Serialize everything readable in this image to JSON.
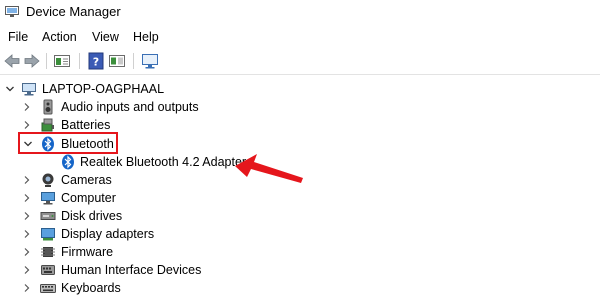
{
  "window": {
    "title": "Device Manager",
    "icon": "device-manager-icon"
  },
  "menu": {
    "items": [
      "File",
      "Action",
      "View",
      "Help"
    ]
  },
  "toolbar": {
    "buttons": [
      "back-icon",
      "forward-icon",
      "properties-icon",
      "help-icon",
      "view-icon",
      "monitor-icon"
    ]
  },
  "tree": {
    "root": "LAPTOP-OAGPHAAL",
    "categories": [
      {
        "label": "Audio inputs and outputs",
        "icon": "speaker-icon",
        "expanded": false
      },
      {
        "label": "Batteries",
        "icon": "battery-icon",
        "expanded": false
      },
      {
        "label": "Bluetooth",
        "icon": "bluetooth-icon",
        "expanded": true,
        "children": [
          {
            "label": "Realtek Bluetooth 4.2 Adapter",
            "icon": "bluetooth-icon"
          }
        ]
      },
      {
        "label": "Cameras",
        "icon": "camera-icon",
        "expanded": false
      },
      {
        "label": "Computer",
        "icon": "computer-icon",
        "expanded": false
      },
      {
        "label": "Disk drives",
        "icon": "disk-drive-icon",
        "expanded": false
      },
      {
        "label": "Display adapters",
        "icon": "display-adapter-icon",
        "expanded": false
      },
      {
        "label": "Firmware",
        "icon": "firmware-icon",
        "expanded": false
      },
      {
        "label": "Human Interface Devices",
        "icon": "hid-icon",
        "expanded": false
      },
      {
        "label": "Keyboards",
        "icon": "keyboard-icon",
        "expanded": false
      }
    ]
  },
  "annotation": {
    "box_color": "#e5161c",
    "arrow_color": "#e5161c"
  }
}
